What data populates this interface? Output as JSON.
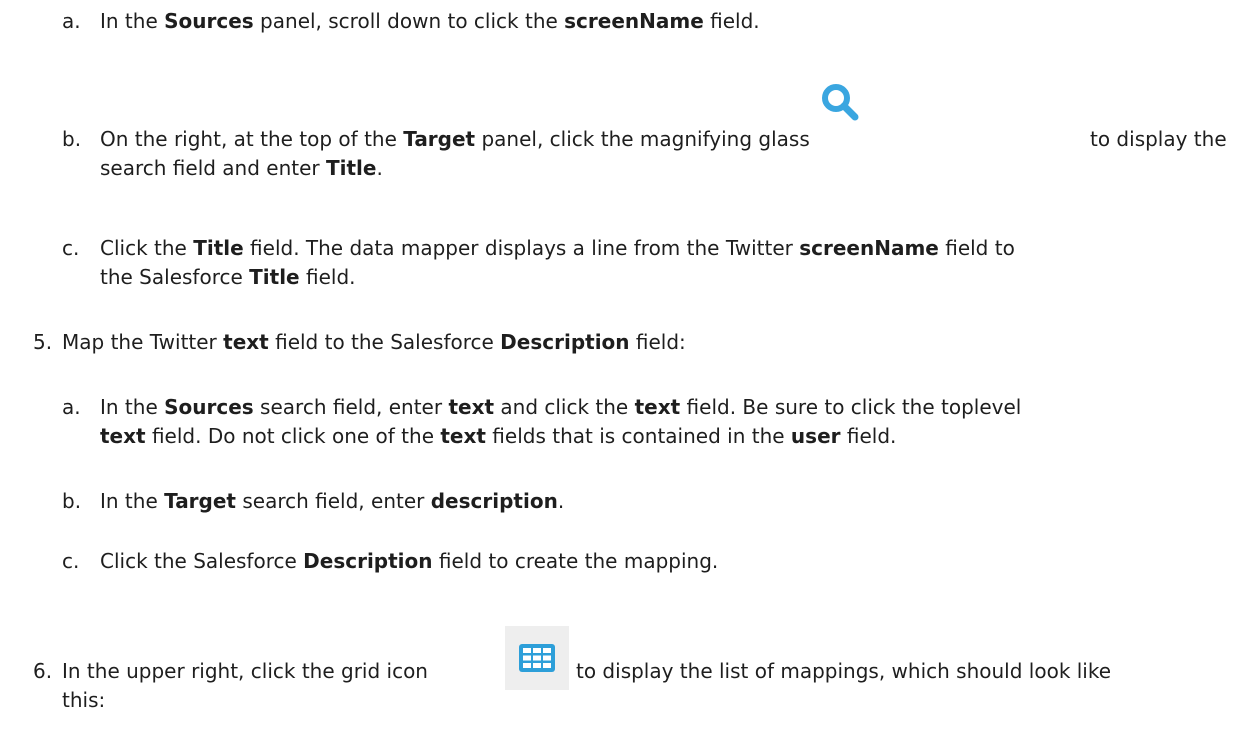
{
  "steps": [
    {
      "marker": "a.",
      "lines": [
        [
          "In the ",
          {
            "b": "Sources"
          },
          " panel, scroll down to click the ",
          {
            "b": "screenName"
          },
          " field."
        ]
      ]
    },
    {
      "marker": "b.",
      "lines": [
        [
          "On the right, at the top of the ",
          {
            "b": "Target"
          },
          " panel, click the magnifying glass"
        ],
        [
          "search field and enter ",
          {
            "b": "Title"
          },
          "."
        ]
      ],
      "icon": "search-icon",
      "trailing_text": "to display the"
    },
    {
      "marker": "c.",
      "lines": [
        [
          "Click the ",
          {
            "b": "Title"
          },
          " field. The data mapper displays a line from the Twitter ",
          {
            "b": "screenName"
          },
          " field to"
        ],
        [
          "the Salesforce ",
          {
            "b": "Title"
          },
          " field."
        ]
      ]
    },
    {
      "marker": "5.",
      "lines": [
        [
          "Map the Twitter ",
          {
            "b": "text"
          },
          " field to the Salesforce ",
          {
            "b": "Description"
          },
          " field:"
        ]
      ]
    },
    {
      "marker": "a.",
      "lines": [
        [
          "In the ",
          {
            "b": "Sources"
          },
          " search field, enter ",
          {
            "b": "text"
          },
          " and click the ",
          {
            "b": "text"
          },
          " field. Be sure to click the toplevel"
        ],
        [
          {
            "b": "text"
          },
          " field. Do not click one of the ",
          {
            "b": "text"
          },
          " fields that is contained in the ",
          {
            "b": "user"
          },
          " field."
        ]
      ]
    },
    {
      "marker": "b.",
      "lines": [
        [
          "In the ",
          {
            "b": "Target"
          },
          " search field, enter ",
          {
            "b": "description"
          },
          "."
        ]
      ]
    },
    {
      "marker": "c.",
      "lines": [
        [
          "Click the Salesforce ",
          {
            "b": "Description"
          },
          " field to create the mapping."
        ]
      ]
    },
    {
      "marker": "6.",
      "lines": [
        [
          "In the upper right, click the grid icon"
        ],
        [
          "this:"
        ]
      ],
      "icon": "grid-icon",
      "trailing_text": "to display the list of mappings, which should look like"
    }
  ],
  "icon_colors": {
    "search": "#3aa6e0",
    "grid_bg": "#eeeeee",
    "grid": "#2d9fd9"
  }
}
